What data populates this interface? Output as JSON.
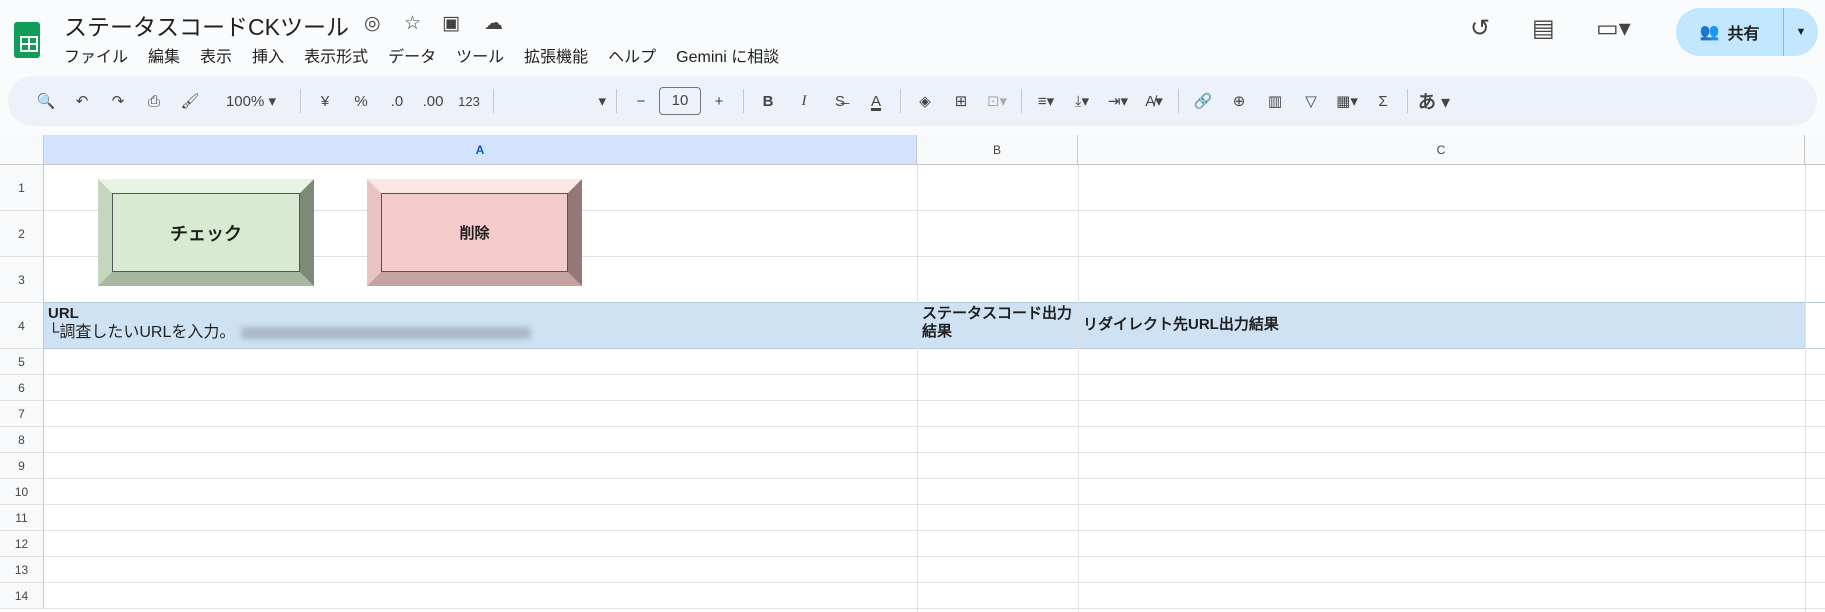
{
  "app": {
    "title": "ステータスコードCKツール",
    "menu": [
      "ファイル",
      "編集",
      "表示",
      "挿入",
      "表示形式",
      "データ",
      "ツール",
      "拡張機能",
      "ヘルプ",
      "Gemini に相談"
    ],
    "share_label": "共有"
  },
  "toolbar": {
    "zoom": "100%",
    "currency": "¥",
    "percent": "%",
    "dec_decrease": ".0",
    "dec_increase": ".00",
    "number_format": "123",
    "font_size": "10",
    "bold": "B",
    "italic": "I",
    "input_tool": "あ"
  },
  "columns": [
    "A",
    "B",
    "C"
  ],
  "rows": [
    "1",
    "2",
    "3",
    "4",
    "5",
    "6",
    "7",
    "8",
    "9",
    "10",
    "11",
    "12",
    "13",
    "14"
  ],
  "buttons": {
    "check": "チェック",
    "delete": "削除",
    "check_color": "#d9ead3",
    "delete_color": "#f4cccc"
  },
  "cells": {
    "A4_line1": "URL",
    "A4_line2": "└調査したいURLを入力。",
    "B4": "ステータスコード出力結果",
    "C4": "リダイレクト先URL出力結果"
  },
  "colors": {
    "header_row": "#cfe2f3",
    "share": "#c2e7ff",
    "selected_col": "#d3e3fd"
  }
}
